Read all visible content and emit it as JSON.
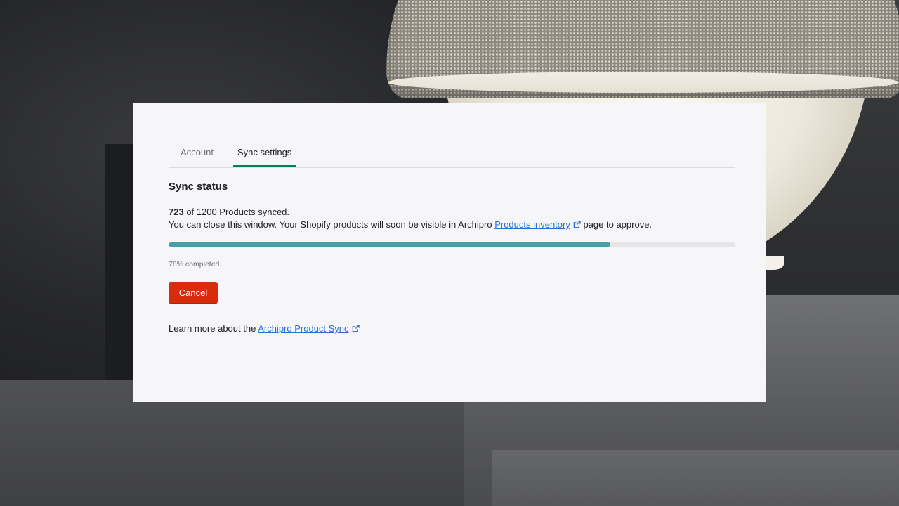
{
  "background": {
    "description_icon": "pendant-lamp-photo"
  },
  "tabs": [
    {
      "label": "Account",
      "active": false
    },
    {
      "label": "Sync settings",
      "active": true
    }
  ],
  "sync": {
    "title": "Sync status",
    "synced_count": "723",
    "synced_suffix": " of 1200 Products synced.",
    "message_prefix": "You can close this window. Your Shopify products will soon be visible in Archipro ",
    "inventory_link": "Products inventory",
    "message_suffix": " page to approve.",
    "progress_percent": 78,
    "progress_caption": "78% completed.",
    "cancel_label": "Cancel"
  },
  "learn_more": {
    "prefix": "Learn more about the ",
    "link": "Archipro Product Sync"
  },
  "colors": {
    "accent_tab": "#008060",
    "progress": "#47a0a6",
    "cancel": "#d82c0d",
    "link": "#2c6ecb"
  }
}
